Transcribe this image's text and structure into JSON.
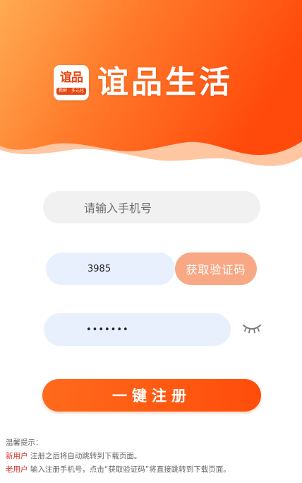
{
  "brand": {
    "logo_mark": "谊品",
    "logo_tagline": "新鲜 · 多元化",
    "name": "谊品生活"
  },
  "form": {
    "phone_placeholder": "请输入手机号",
    "code_value": "3985",
    "get_code_label": "获取验证码",
    "password_value": "•••••••",
    "register_label": "一键注册"
  },
  "tips": {
    "title": "温馨提示：",
    "new_user_tag": "新用户",
    "new_user_text": " 注册之后将自动跳转到下载页面。",
    "old_user_tag": "老用户",
    "old_user_text": " 输入注册手机号，点击“获取验证码”将直接跳转到下载页面。"
  },
  "icons": {
    "password_toggle": "eye-closed-icon"
  },
  "colors": {
    "accent": "#ff4d0b",
    "accent_light": "#f8a884",
    "input_bg": "#f1f1f1",
    "autofill_bg": "#e8f0fe",
    "tip_tag": "#d0342c"
  }
}
